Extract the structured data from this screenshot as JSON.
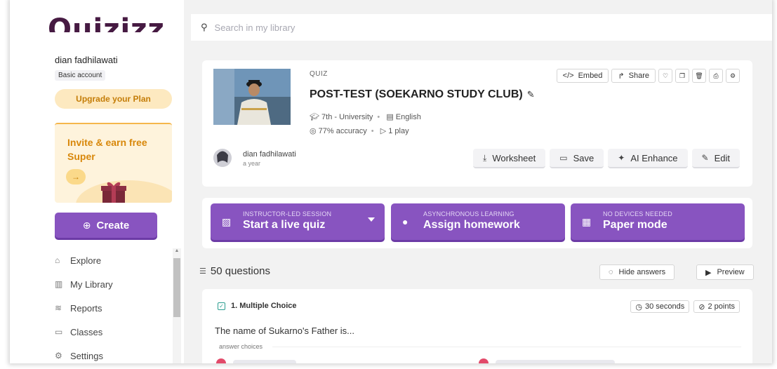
{
  "sidebar": {
    "logo": "Quizizz",
    "user_name": "dian fadhilawati",
    "account_type": "Basic account",
    "upgrade_label": "Upgrade your Plan",
    "invite_title": "Invite & earn free Super",
    "invite_arrow": "→",
    "create_label": "Create",
    "nav": [
      {
        "label": "Explore",
        "icon": "compass-icon"
      },
      {
        "label": "My Library",
        "icon": "library-icon"
      },
      {
        "label": "Reports",
        "icon": "chart-icon"
      },
      {
        "label": "Classes",
        "icon": "classes-icon"
      },
      {
        "label": "Settings",
        "icon": "gear-icon"
      }
    ]
  },
  "search": {
    "placeholder": "Search in my library"
  },
  "quiz": {
    "type": "QUIZ",
    "title": "POST-TEST (SOEKARNO STUDY CLUB)",
    "grade": "7th - University",
    "language": "English",
    "accuracy": "77% accuracy",
    "plays": "1 play",
    "embed_label": "Embed",
    "share_label": "Share",
    "author": "dian fadhilawati",
    "author_time": "a year",
    "worksheet_label": "Worksheet",
    "save_label": "Save",
    "ai_label": "AI Enhance",
    "edit_label": "Edit"
  },
  "modes": [
    {
      "sub": "INSTRUCTOR-LED SESSION",
      "title": "Start a live quiz"
    },
    {
      "sub": "ASYNCHRONOUS LEARNING",
      "title": "Assign homework"
    },
    {
      "sub": "NO DEVICES NEEDED",
      "title": "Paper mode"
    }
  ],
  "questions": {
    "count_label": "50 questions",
    "hide_label": "Hide answers",
    "preview_label": "Preview",
    "first": {
      "header": "1. Multiple Choice",
      "time": "30 seconds",
      "points": "2 points",
      "text": "The name of Sukarno's Father is...",
      "answers_label": "answer choices"
    }
  },
  "colors": {
    "brand": "#8854c0",
    "logo": "#461a42",
    "accent": "#f5b64c",
    "answer": "#e24a6a"
  }
}
